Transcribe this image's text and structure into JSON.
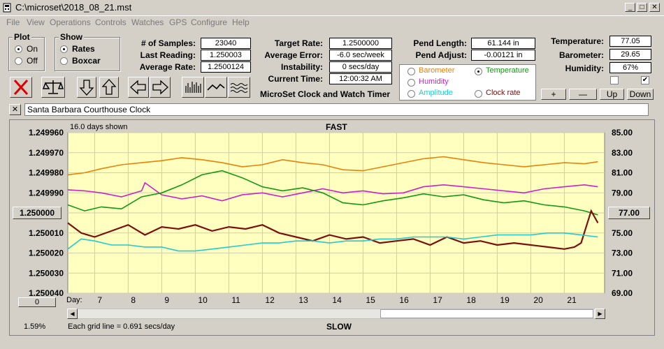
{
  "window": {
    "title": "C:\\microset\\2018_08_21.mst",
    "min": "_",
    "max": "□",
    "close": "✕"
  },
  "menu": [
    "File",
    "View",
    "Operations",
    "Controls",
    "Watches",
    "GPS",
    "Configure",
    "Help"
  ],
  "plot_group": {
    "title": "Plot",
    "options": [
      "On",
      "Off"
    ],
    "selected": "On"
  },
  "show_group": {
    "title": "Show",
    "options": [
      "Rates",
      "Boxcar"
    ],
    "selected": "Rates"
  },
  "stats": {
    "samples_label": "# of Samples:",
    "samples": "23040",
    "last_label": "Last Reading:",
    "last": "1.250003",
    "avg_label": "Average Rate:",
    "avg": "1.2500124",
    "target_label": "Target Rate:",
    "target": "1.2500000",
    "err_label": "Average Error:",
    "err": "-6.0 sec/week",
    "inst_label": "Instability:",
    "inst": "0 secs/day",
    "time_label": "Current Time:",
    "time": "12:00:32 AM",
    "pendlen_label": "Pend Length:",
    "pendlen": "61.144 in",
    "pendadj_label": "Pend Adjust:",
    "pendadj": "-0.00121 in",
    "temp_label": "Temperature:",
    "temp": "77.05",
    "baro_label": "Barometer:",
    "baro": "29.65",
    "hum_label": "Humidity:",
    "hum": "67%"
  },
  "timer_title": "MicroSet Clock and Watch Timer",
  "sensor_options": [
    {
      "label": "Barometer",
      "color": "#e8820a",
      "selected": false
    },
    {
      "label": "Temperature",
      "color": "#119911",
      "selected": true
    },
    {
      "label": "Humidity",
      "color": "#cc22cc",
      "selected": false
    },
    {
      "label": "Clock rate",
      "color": "#7a1010",
      "selected": false
    },
    {
      "label": "Amplitude",
      "color": "#22cccc",
      "selected": false
    }
  ],
  "small_buttons": [
    "+",
    "—",
    "Up",
    "Down"
  ],
  "clock_name": "Santa Barbara Courthouse Clock",
  "clear_label": "✕",
  "chart": {
    "days_shown": "16.0 days shown",
    "top_label": "FAST",
    "bottom_label": "SLOW",
    "grid_note": "Each grid line = 0.691 secs/day",
    "percent": "1.59%",
    "day_label": "Day:",
    "left_button": "1.250000",
    "right_button": "77.00",
    "zero_button": "0"
  },
  "chart_data": {
    "type": "line",
    "x_ticks": [
      "7",
      "8",
      "9",
      "10",
      "11",
      "12",
      "13",
      "14",
      "15",
      "16",
      "17",
      "18",
      "19",
      "20",
      "21"
    ],
    "x_range": [
      6.2,
      22.2
    ],
    "left_ticks": [
      "1.249960",
      "1.249970",
      "1.249980",
      "1.249990",
      "",
      "1.250010",
      "1.250020",
      "1.250030",
      "1.250040"
    ],
    "right_ticks": [
      "85.00",
      "83.00",
      "81.00",
      "79.00",
      "",
      "75.00",
      "73.00",
      "71.00",
      "69.00"
    ],
    "left_range": [
      1.24996,
      1.25004
    ],
    "right_range": [
      69,
      85
    ],
    "series": [
      {
        "name": "Barometer",
        "color": "#e8820a",
        "axis": "right",
        "x": [
          6.2,
          6.7,
          7.2,
          7.8,
          8.4,
          9.0,
          9.6,
          10.2,
          10.8,
          11.4,
          12.0,
          12.6,
          13.2,
          13.8,
          14.4,
          15.0,
          15.6,
          16.2,
          16.8,
          17.4,
          18.0,
          18.6,
          19.2,
          19.8,
          20.4,
          21.0,
          21.6,
          22.0
        ],
        "y": [
          80.8,
          81.0,
          81.4,
          81.8,
          82.0,
          82.2,
          82.5,
          82.3,
          82.0,
          81.6,
          81.8,
          82.3,
          82.0,
          81.8,
          81.3,
          81.2,
          81.6,
          82.0,
          82.4,
          82.6,
          82.3,
          82.0,
          81.8,
          81.6,
          81.8,
          82.0,
          81.9,
          82.1
        ]
      },
      {
        "name": "Humidity",
        "color": "#cc22cc",
        "axis": "right",
        "x": [
          6.2,
          6.7,
          7.2,
          7.8,
          8.4,
          8.5,
          9.0,
          9.6,
          10.2,
          10.8,
          11.4,
          12.0,
          12.6,
          13.2,
          13.8,
          14.4,
          15.0,
          15.6,
          16.2,
          16.8,
          17.4,
          18.0,
          18.6,
          19.2,
          19.8,
          20.4,
          21.0,
          21.6,
          22.0
        ],
        "y": [
          79.3,
          79.2,
          79.0,
          78.6,
          79.2,
          80.0,
          78.8,
          78.4,
          78.7,
          78.2,
          78.8,
          79.0,
          78.6,
          79.0,
          79.4,
          79.0,
          79.2,
          78.9,
          79.0,
          79.6,
          79.8,
          79.6,
          79.4,
          79.2,
          79.0,
          79.4,
          79.6,
          79.8,
          79.6
        ]
      },
      {
        "name": "Temperature",
        "color": "#119911",
        "axis": "right",
        "x": [
          6.2,
          6.7,
          7.2,
          7.8,
          8.4,
          9.0,
          9.6,
          10.2,
          10.8,
          11.4,
          12.0,
          12.6,
          13.2,
          13.8,
          14.4,
          15.0,
          15.6,
          16.2,
          16.8,
          17.4,
          18.0,
          18.6,
          19.2,
          19.8,
          20.4,
          21.0,
          21.6,
          22.0
        ],
        "y": [
          77.8,
          77.2,
          77.6,
          77.4,
          78.6,
          79.0,
          79.8,
          80.8,
          81.2,
          80.5,
          79.6,
          79.2,
          79.5,
          79.0,
          78.0,
          77.8,
          78.2,
          78.5,
          78.9,
          78.6,
          78.8,
          78.3,
          78.0,
          78.2,
          77.8,
          77.6,
          77.2,
          76.8
        ]
      },
      {
        "name": "Clock rate",
        "color": "#7a1010",
        "axis": "left",
        "x": [
          6.2,
          6.6,
          7.0,
          7.5,
          8.0,
          8.5,
          9.0,
          9.5,
          10.0,
          10.5,
          11.0,
          11.5,
          12.0,
          12.5,
          13.0,
          13.5,
          14.0,
          14.5,
          15.0,
          15.5,
          16.0,
          16.5,
          17.0,
          17.5,
          18.0,
          18.5,
          19.0,
          19.5,
          20.0,
          20.5,
          21.0,
          21.3,
          21.5,
          21.8,
          22.0
        ],
        "y": [
          1.250005,
          1.25001,
          1.250012,
          1.250009,
          1.250006,
          1.250011,
          1.250007,
          1.250008,
          1.250006,
          1.250009,
          1.250007,
          1.250008,
          1.250006,
          1.25001,
          1.250012,
          1.250014,
          1.250011,
          1.250013,
          1.250012,
          1.250015,
          1.250014,
          1.250013,
          1.250016,
          1.250012,
          1.250015,
          1.250014,
          1.250016,
          1.250015,
          1.250016,
          1.250017,
          1.250018,
          1.250017,
          1.250015,
          1.249999,
          1.250005
        ]
      },
      {
        "name": "Amplitude",
        "color": "#22cccc",
        "axis": "left",
        "x": [
          6.2,
          6.6,
          7.0,
          7.5,
          8.0,
          8.5,
          9.0,
          9.5,
          10.0,
          10.5,
          11.0,
          11.5,
          12.0,
          12.5,
          13.0,
          13.5,
          14.0,
          14.5,
          15.0,
          15.5,
          16.0,
          16.5,
          17.0,
          17.5,
          18.0,
          18.5,
          19.0,
          19.5,
          20.0,
          20.5,
          21.0,
          21.5,
          22.0
        ],
        "y": [
          1.250018,
          1.250013,
          1.250014,
          1.250016,
          1.250016,
          1.250017,
          1.250017,
          1.250019,
          1.250019,
          1.250018,
          1.250017,
          1.250016,
          1.250015,
          1.250015,
          1.250014,
          1.250014,
          1.250015,
          1.250014,
          1.250014,
          1.250013,
          1.250013,
          1.250012,
          1.250012,
          1.250012,
          1.250013,
          1.250012,
          1.250011,
          1.250011,
          1.250011,
          1.25001,
          1.25001,
          1.250011,
          1.250012
        ]
      }
    ]
  }
}
